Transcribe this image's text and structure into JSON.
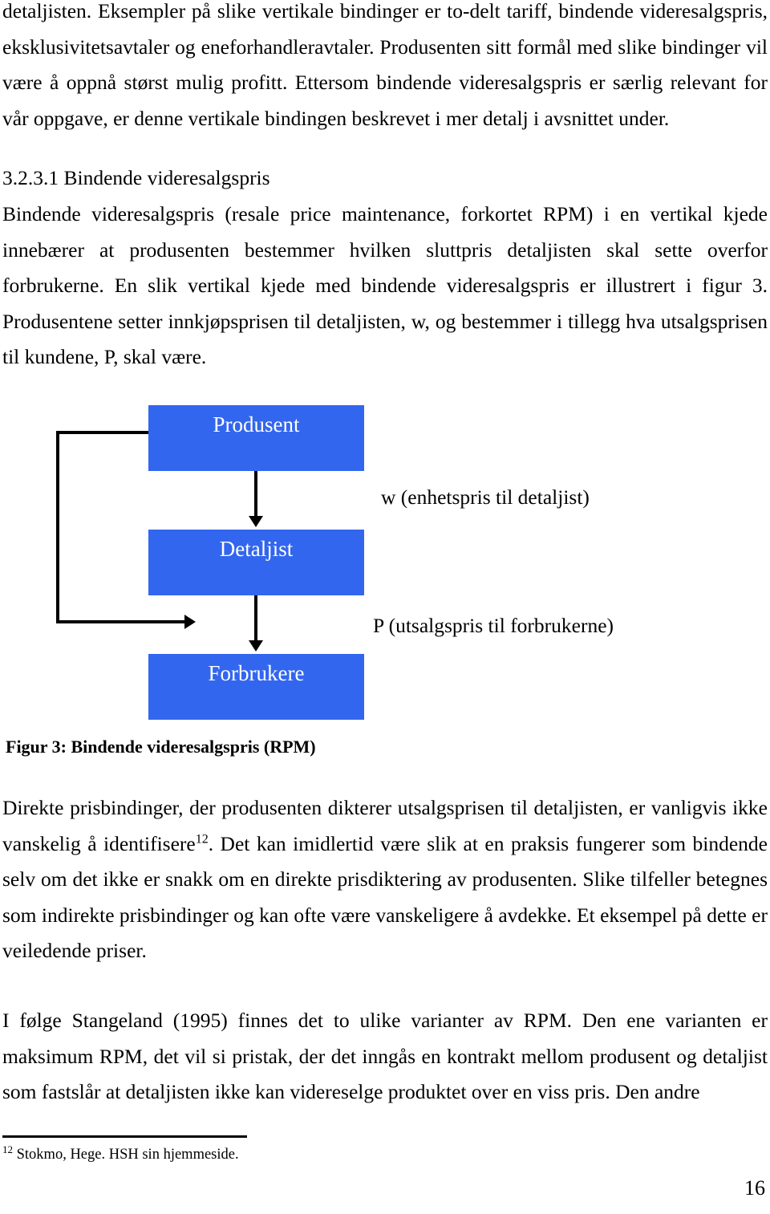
{
  "document": {
    "page_number": "16"
  },
  "paragraphs": {
    "intro": "detaljisten. Eksempler på slike vertikale bindinger er to-delt tariff, bindende videresalgspris, eksklusivitetsavtaler og eneforhandleravtaler. Produsenten sitt formål med slike bindinger vil være å oppnå størst mulig profitt. Ettersom bindende videresalgspris er særlig relevant for vår oppgave, er denne vertikale bindingen beskrevet i mer detalj i avsnittet under.",
    "rpm": "Bindende videresalgspris (resale price maintenance, forkortet RPM) i en vertikal kjede innebærer at produsenten bestemmer hvilken sluttpris detaljisten skal sette overfor forbrukerne. En slik vertikal kjede med bindende videresalgspris er illustrert i figur 3. Produsentene setter innkjøpsprisen til detaljisten, w, og bestemmer i tillegg hva utsalgsprisen til kundene, P, skal være.",
    "direct_part1": "Direkte prisbindinger, der produsenten dikterer utsalgsprisen til detaljisten, er vanligvis ikke vanskelig å identifisere",
    "direct_footnote_marker": "12",
    "direct_part2": ". Det kan imidlertid være slik at en praksis fungerer som bindende selv om det ikke er snakk om en direkte prisdiktering av produsenten. Slike tilfeller betegnes som indirekte prisbindinger og kan ofte være vanskeligere å avdekke. Et eksempel på dette er veiledende priser.",
    "stangeland": "I følge Stangeland (1995) finnes det to ulike varianter av RPM. Den ene varianten er maksimum RPM, det vil si pristak, der det inngås en kontrakt mellom produsent og detaljist som fastslår at detaljisten ikke kan videreselge produktet over en viss pris. Den andre"
  },
  "heading": {
    "number_and_title": "3.2.3.1 Bindende videresalgspris"
  },
  "figure": {
    "caption": "Figur 3: Bindende videresalgspris (RPM)",
    "box_color": "#3366EE",
    "box_text_color": "#ffffff",
    "line_color": "#000000",
    "nodes": [
      {
        "id": "produsent",
        "label": "Produsent"
      },
      {
        "id": "detaljist",
        "label": "Detaljist"
      },
      {
        "id": "forbrukere",
        "label": "Forbrukere"
      }
    ],
    "edge_labels": {
      "w": "w (enhetspris til detaljist)",
      "p": "P (utsalgspris til forbrukerne)"
    }
  },
  "footnote": {
    "marker": "12",
    "text": "Stokmo, Hege. HSH sin hjemmeside."
  }
}
